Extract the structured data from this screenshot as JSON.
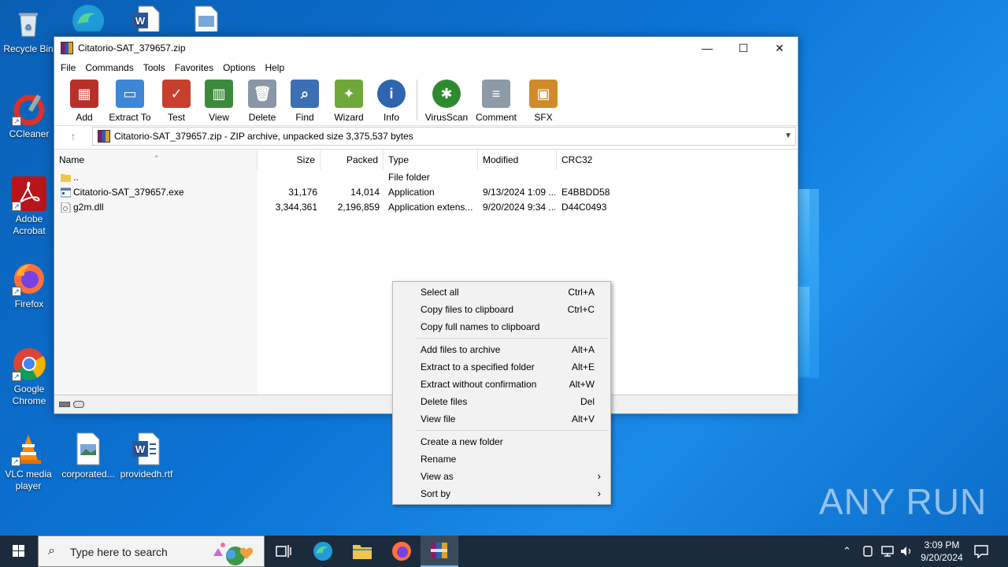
{
  "desktop": {
    "icons": [
      {
        "label": "Recycle Bin"
      },
      {
        "label": "CCleaner"
      },
      {
        "label": "Adobe Acrobat"
      },
      {
        "label": "Firefox"
      },
      {
        "label": "Google Chrome"
      },
      {
        "label": "VLC media player"
      },
      {
        "label": "corporated..."
      },
      {
        "label": "providedh.rtf"
      }
    ],
    "watermark": "ANY RUN"
  },
  "window": {
    "title": "Citatorio-SAT_379657.zip",
    "controls": {
      "minimize": "—",
      "maximize": "☐",
      "close": "✕"
    },
    "menu": [
      "File",
      "Commands",
      "Tools",
      "Favorites",
      "Options",
      "Help"
    ],
    "toolbar": [
      {
        "label": "Add",
        "icon": "add-archive-icon",
        "color": "#b8302a"
      },
      {
        "label": "Extract To",
        "icon": "folder-extract-icon",
        "color": "#3e86d6"
      },
      {
        "label": "Test",
        "icon": "test-clipboard-icon",
        "color": "#c8402c"
      },
      {
        "label": "View",
        "icon": "book-view-icon",
        "color": "#3b8a3b"
      },
      {
        "label": "Delete",
        "icon": "trash-icon",
        "color": "#8a97a6"
      },
      {
        "label": "Find",
        "icon": "magnifier-icon",
        "color": "#3c6fb4"
      },
      {
        "label": "Wizard",
        "icon": "magic-wand-icon",
        "color": "#6fa83a"
      },
      {
        "label": "Info",
        "icon": "info-icon",
        "color": "#2f64b0"
      },
      {
        "label": "VirusScan",
        "icon": "bug-shield-icon",
        "color": "#2e8a2e"
      },
      {
        "label": "Comment",
        "icon": "comment-icon",
        "color": "#8d9aa8"
      },
      {
        "label": "SFX",
        "icon": "sfx-box-icon",
        "color": "#d08a2a"
      }
    ],
    "address": "Citatorio-SAT_379657.zip - ZIP archive, unpacked size 3,375,537 bytes",
    "columns": [
      "Name",
      "Size",
      "Packed",
      "Type",
      "Modified",
      "CRC32"
    ],
    "files": [
      {
        "name": "..",
        "size": "",
        "packed": "",
        "type": "File folder",
        "modified": "",
        "crc": "",
        "icon": "folder-icon"
      },
      {
        "name": "Citatorio-SAT_379657.exe",
        "size": "31,176",
        "packed": "14,014",
        "type": "Application",
        "modified": "9/13/2024 1:09 ...",
        "crc": "E4BBDD58",
        "icon": "exe-icon"
      },
      {
        "name": "g2m.dll",
        "size": "3,344,361",
        "packed": "2,196,859",
        "type": "Application extens...",
        "modified": "9/20/2024 9:34 ...",
        "crc": "D44C0493",
        "icon": "dll-icon"
      }
    ]
  },
  "context_menu": {
    "items": [
      {
        "label": "Select all",
        "shortcut": "Ctrl+A"
      },
      {
        "label": "Copy files to clipboard",
        "shortcut": "Ctrl+C"
      },
      {
        "label": "Copy full names to clipboard",
        "shortcut": ""
      },
      {
        "label": "Add files to archive",
        "shortcut": "Alt+A"
      },
      {
        "label": "Extract to a specified folder",
        "shortcut": "Alt+E"
      },
      {
        "label": "Extract without confirmation",
        "shortcut": "Alt+W"
      },
      {
        "label": "Delete files",
        "shortcut": "Del"
      },
      {
        "label": "View file",
        "shortcut": "Alt+V"
      },
      {
        "label": "Create a new folder",
        "shortcut": ""
      },
      {
        "label": "Rename",
        "shortcut": ""
      },
      {
        "label": "View as",
        "shortcut": "",
        "submenu": true
      },
      {
        "label": "Sort by",
        "shortcut": "",
        "submenu": true
      }
    ]
  },
  "taskbar": {
    "search_placeholder": "Type here to search",
    "time": "3:09 PM",
    "date": "9/20/2024"
  }
}
